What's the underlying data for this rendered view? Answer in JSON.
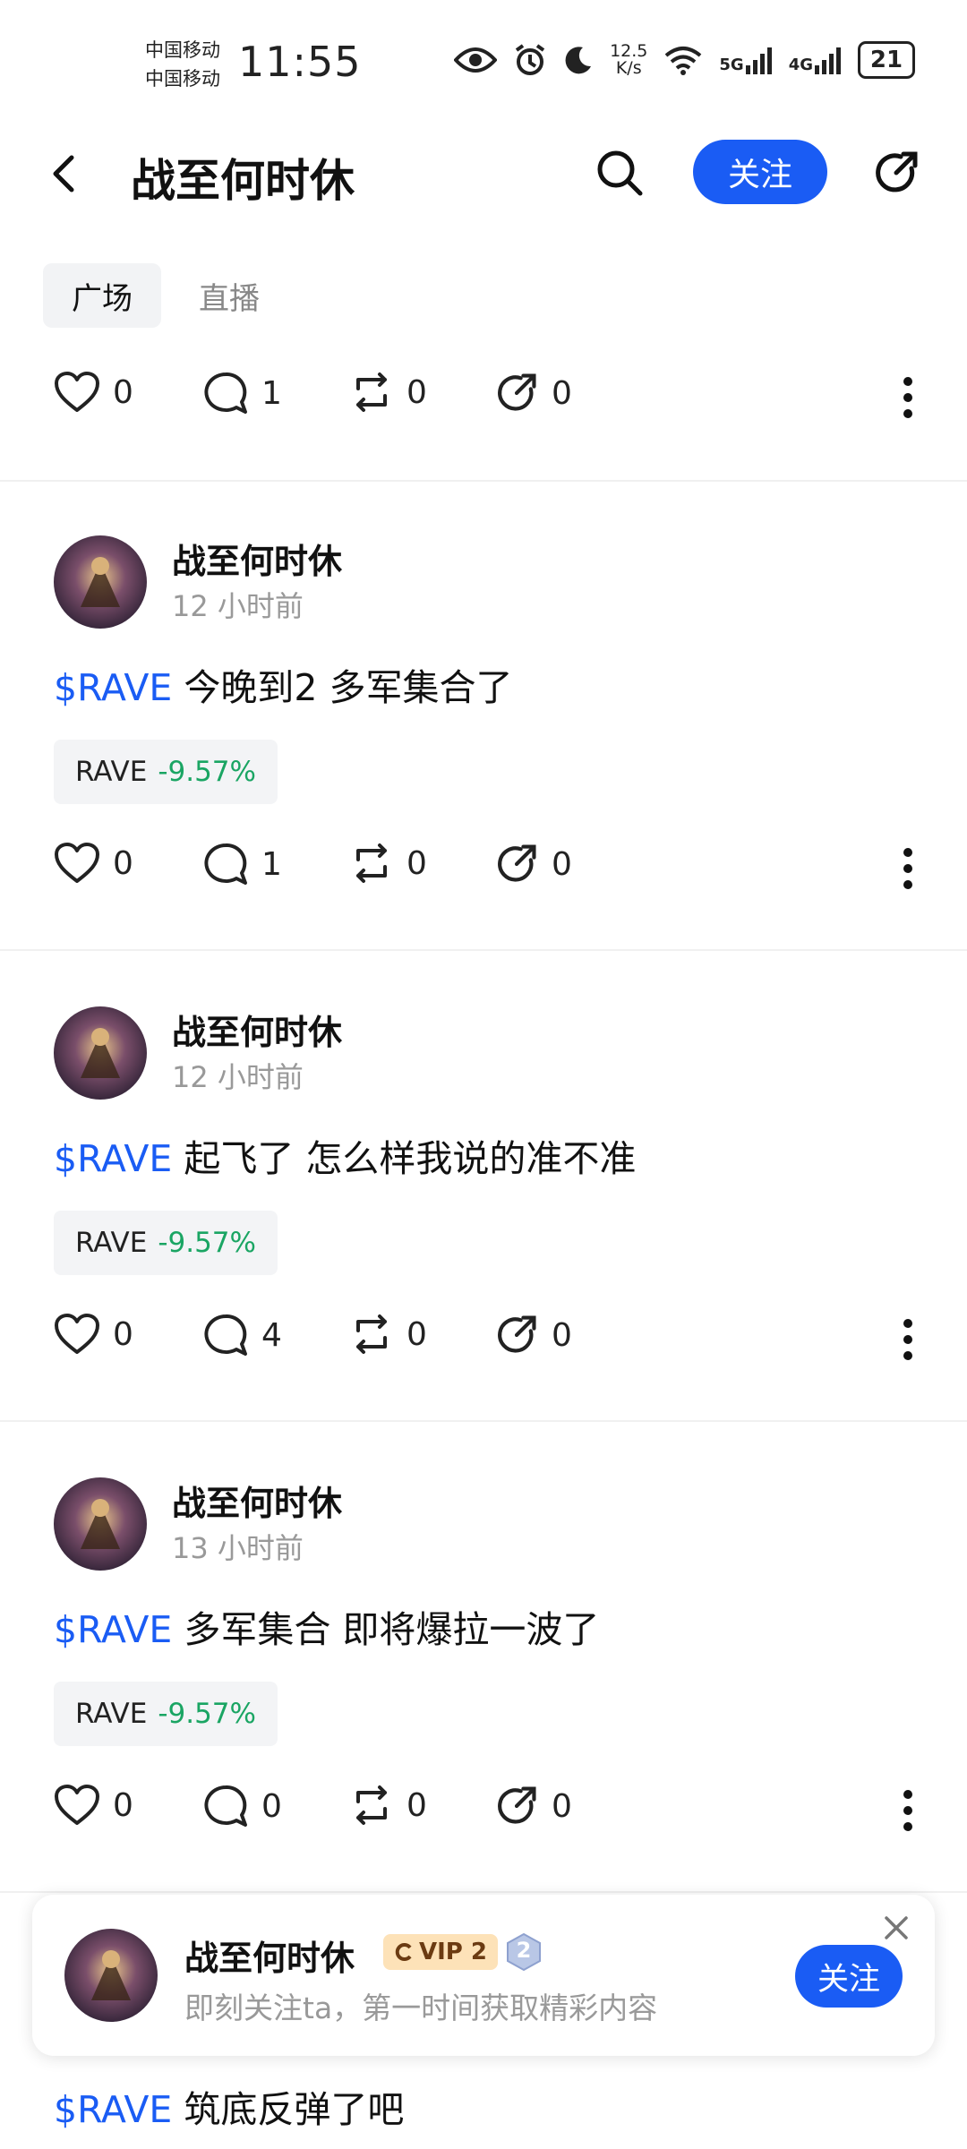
{
  "status_bar": {
    "carrier_1": "中国移动",
    "carrier_2": "中国移动",
    "time": "11:55",
    "speed_value": "12.5",
    "speed_unit": "K/s",
    "net_1": "5G",
    "net_2": "4G",
    "battery": "21"
  },
  "header": {
    "title": "战至何时休",
    "follow_label": "关注"
  },
  "tabs": [
    {
      "label": "广场",
      "active": true
    },
    {
      "label": "直播",
      "active": false
    }
  ],
  "first_actions": {
    "likes": "0",
    "comments": "1",
    "reposts": "0",
    "shares": "0"
  },
  "posts": [
    {
      "author": "战至何时休",
      "time": "12 小时前",
      "tag": "$RAVE",
      "text": "今晚到2 多军集合了",
      "chip_symbol": "RAVE",
      "chip_change": "-9.57%",
      "likes": "0",
      "comments": "1",
      "reposts": "0",
      "shares": "0"
    },
    {
      "author": "战至何时休",
      "time": "12 小时前",
      "tag": "$RAVE",
      "text": "起飞了 怎么样我说的准不准",
      "chip_symbol": "RAVE",
      "chip_change": "-9.57%",
      "likes": "0",
      "comments": "4",
      "reposts": "0",
      "shares": "0"
    },
    {
      "author": "战至何时休",
      "time": "13 小时前",
      "tag": "$RAVE",
      "text": "多军集合 即将爆拉一波了",
      "chip_symbol": "RAVE",
      "chip_change": "-9.57%",
      "likes": "0",
      "comments": "0",
      "reposts": "0",
      "shares": "0"
    }
  ],
  "last_post": {
    "tag": "$RAVE",
    "text": "筑底反弹了吧"
  },
  "follow_card": {
    "name": "战至何时休",
    "vip": "VIP 2",
    "level": "2",
    "subtitle": "即刻关注ta，第一时间获取精彩内容",
    "follow_label": "关注"
  },
  "colors": {
    "accent": "#1a5cf4",
    "down_change": "#1aa563",
    "chip_bg": "#f3f4f6"
  }
}
